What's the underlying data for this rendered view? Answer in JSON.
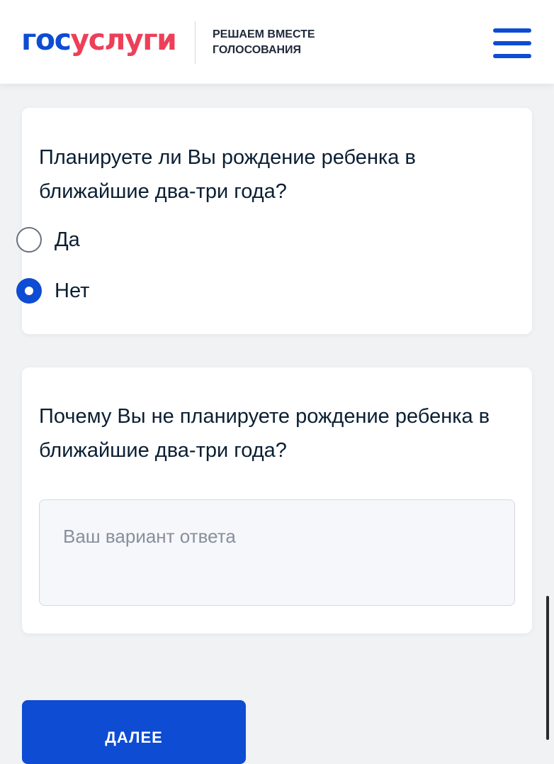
{
  "header": {
    "logo_part1": "гос",
    "logo_part2": "услуги",
    "caption_line1": "РЕШАЕМ ВМЕСТЕ",
    "caption_line2": "ГОЛОСОВАНИЯ",
    "menu_icon": "hamburger-menu-icon"
  },
  "question1": {
    "text": "Планируете ли Вы рождение ребенка в ближайшие два-три года?",
    "options": [
      {
        "label": "Да",
        "selected": false
      },
      {
        "label": "Нет",
        "selected": true
      }
    ]
  },
  "question2": {
    "text": "Почему Вы не планируете рождение ребенка в ближайшие два-три года?",
    "input_placeholder": "Ваш вариант ответа",
    "input_value": ""
  },
  "next_button": {
    "label": "ДАЛЕЕ"
  },
  "colors": {
    "brand_blue": "#0d4cd3",
    "brand_red": "#ee3f58",
    "page_background": "#f1f2f4"
  }
}
